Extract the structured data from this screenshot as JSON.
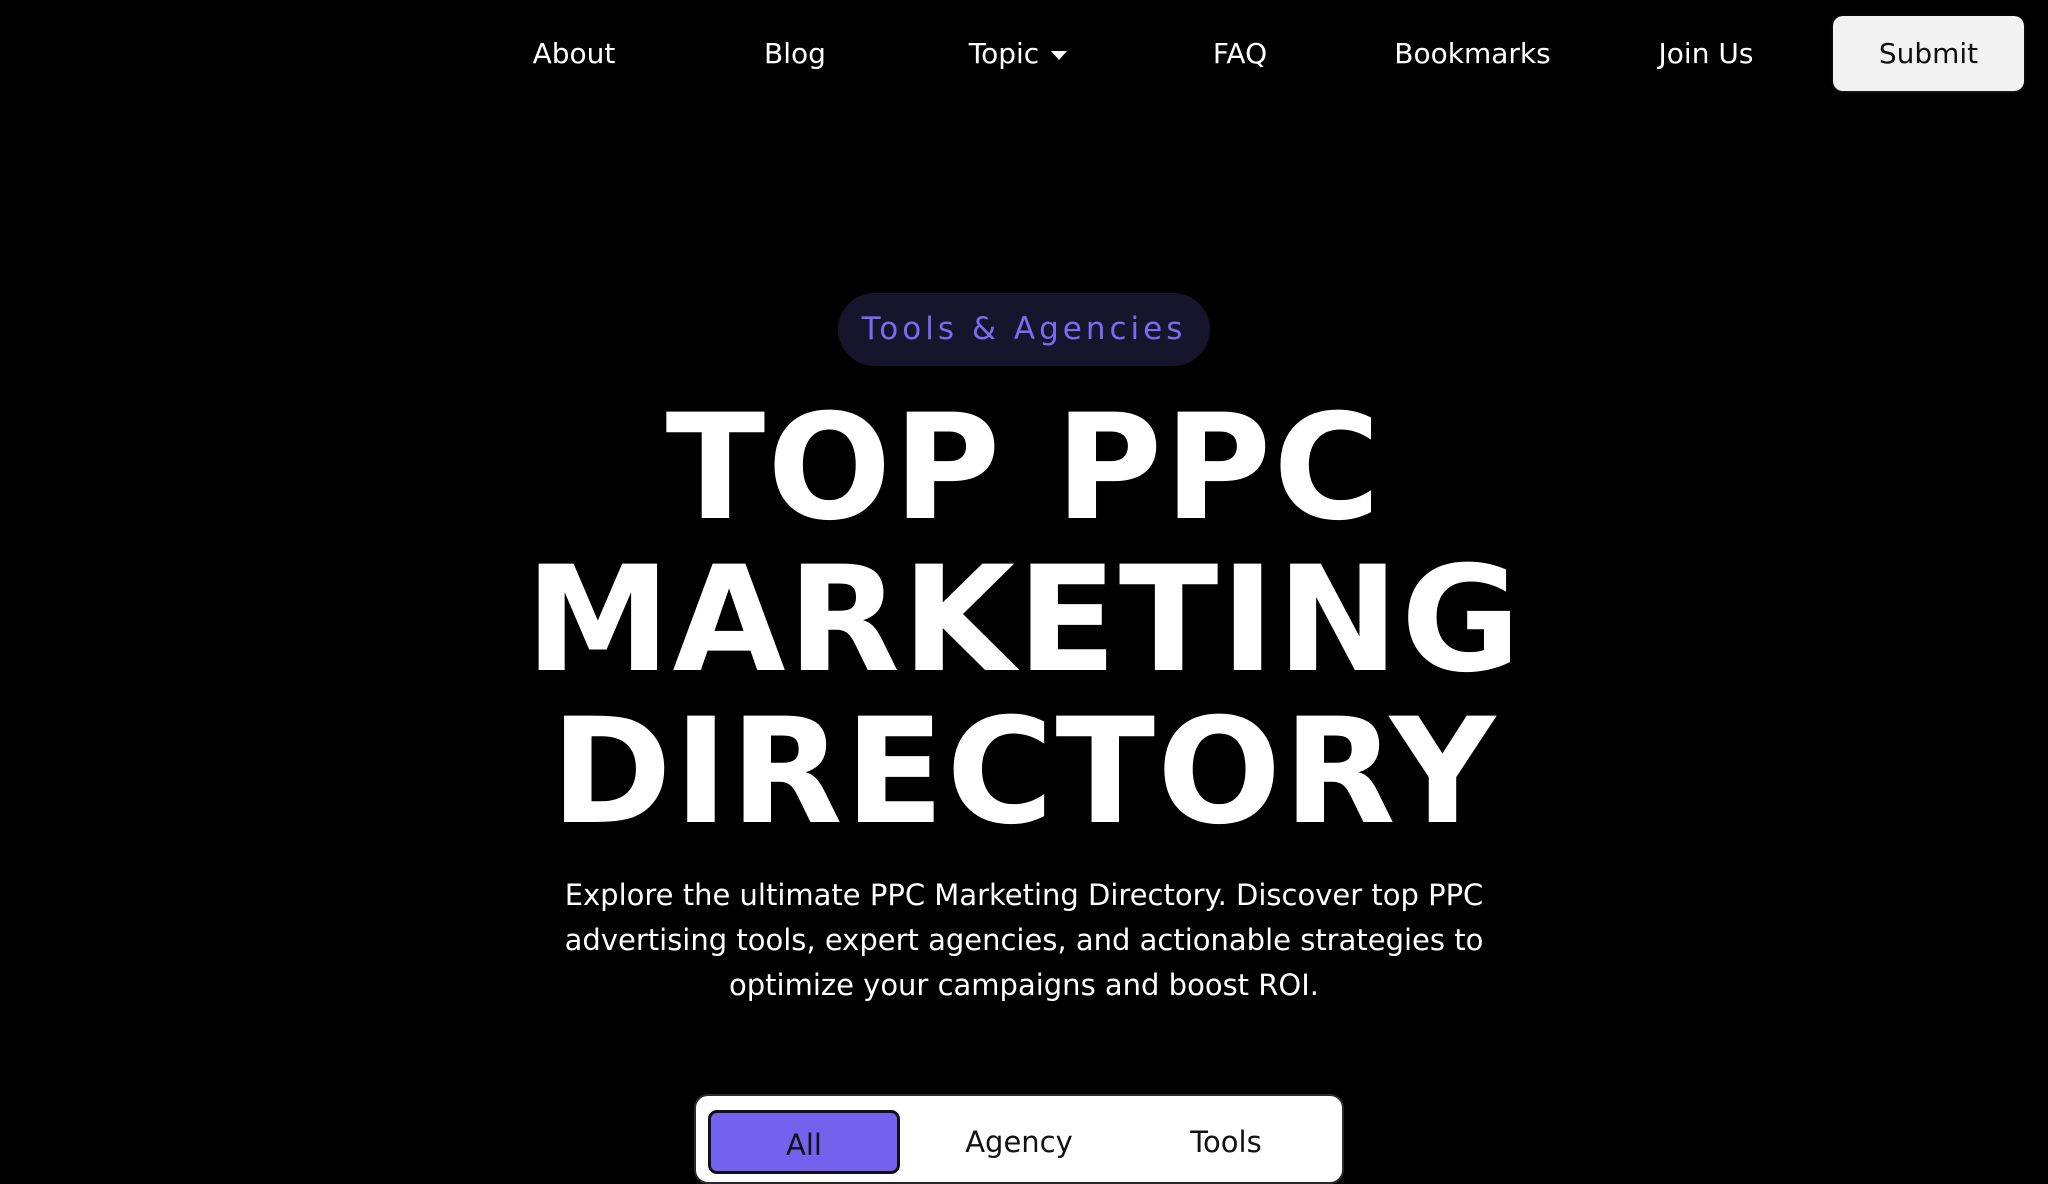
{
  "nav": {
    "items": [
      {
        "label": "About"
      },
      {
        "label": "Blog"
      },
      {
        "label": "Topic",
        "icon": "caret-down-icon"
      },
      {
        "label": "FAQ"
      },
      {
        "label": "Bookmarks"
      },
      {
        "label": "Join Us"
      }
    ],
    "submit_label": "Submit"
  },
  "hero": {
    "badge": "Tools & Agencies",
    "title_lines": [
      "TOP PPC",
      "MARKETING",
      "DIRECTORY"
    ],
    "description": "Explore the ultimate PPC Marketing Directory. Discover top PPC advertising tools, expert agencies, and actionable strategies to optimize your campaigns and boost ROI."
  },
  "filters": {
    "tabs": [
      {
        "label": "All",
        "active": true
      },
      {
        "label": "Agency",
        "active": false
      },
      {
        "label": "Tools",
        "active": false
      }
    ]
  },
  "colors": {
    "background": "#000000",
    "accent": "#7461ee",
    "badge_background": "#16152c",
    "badge_text": "#7d6af0",
    "submit_background": "#f2f2f2"
  }
}
